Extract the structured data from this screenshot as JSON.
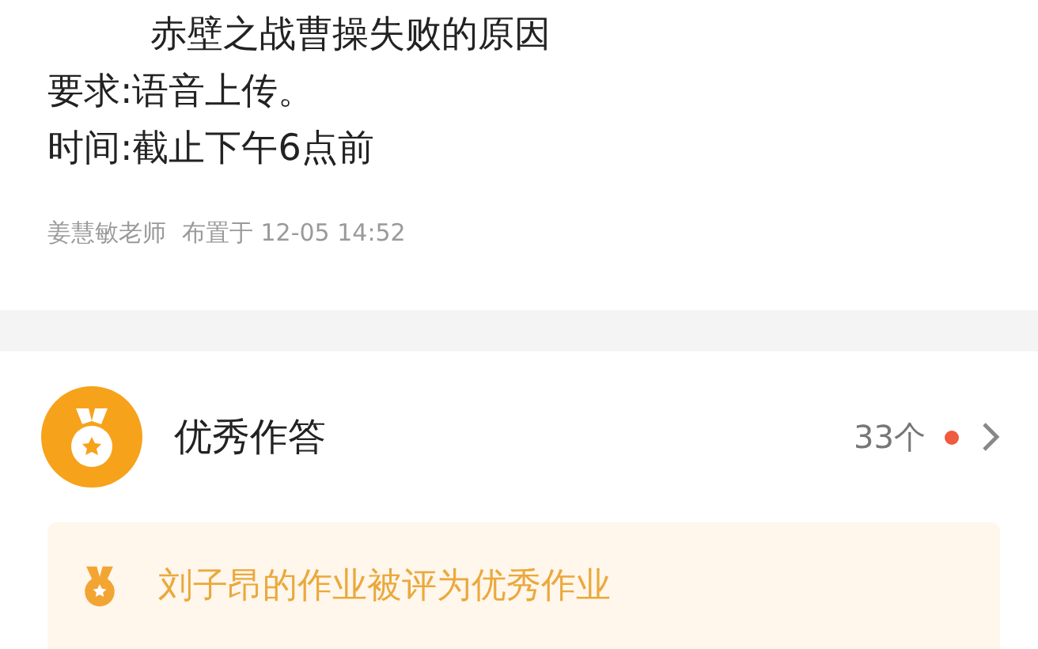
{
  "assignment": {
    "lines": [
      "赤壁之战曹操失败的原因",
      "要求:语音上传。",
      "时间:截止下午6点前"
    ],
    "teacher": "姜慧敏老师",
    "posted": "布置于 12-05 14:52"
  },
  "excellent": {
    "title": "优秀作答",
    "count": "33个",
    "has_new": true,
    "notice": "刘子昂的作业被评为优秀作业"
  }
}
